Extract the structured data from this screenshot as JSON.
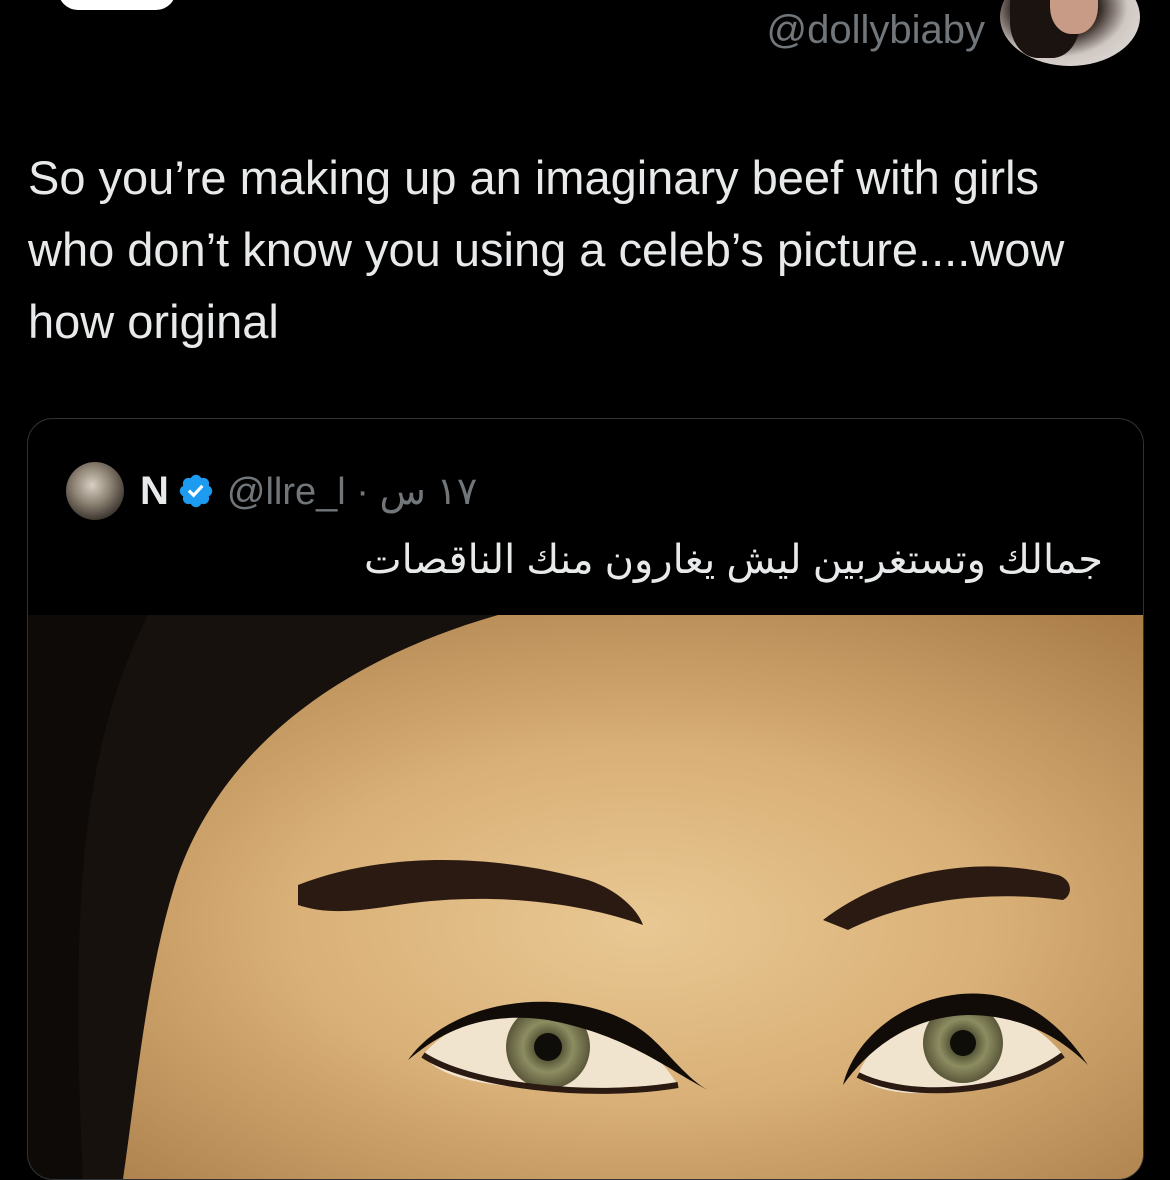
{
  "reply": {
    "handle": "@dollybiaby",
    "text": "So you’re making up an imaginary beef with girls who don’t know you using a celeb’s picture....wow how original"
  },
  "quoted_tweet": {
    "display_name": "N",
    "handle_and_time": "@llre_l · ١٧ س",
    "text": "جمالك وتستغربين ليش يغارون منك الناقصات",
    "verified_color": "#1d9bf0"
  },
  "colors": {
    "background": "#000000",
    "text": "#e7e9ea",
    "secondary_text": "#71767b",
    "border": "#2f3336"
  }
}
